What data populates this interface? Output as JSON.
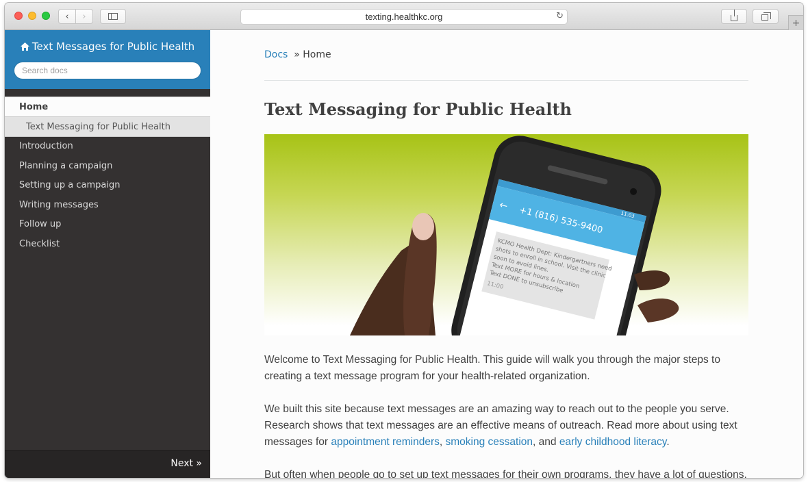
{
  "browser": {
    "url": "texting.healthkc.org",
    "back_glyph": "‹",
    "forward_glyph": "›",
    "reload_glyph": "↻",
    "new_tab_glyph": "+"
  },
  "sidebar": {
    "title": "Text Messages for Public Health",
    "home_icon": "home-icon",
    "search_placeholder": "Search docs",
    "current_item": "Home",
    "sub_item": "Text Messaging for Public Health",
    "items": [
      {
        "label": "Introduction"
      },
      {
        "label": "Planning a campaign"
      },
      {
        "label": "Setting up a campaign"
      },
      {
        "label": "Writing messages"
      },
      {
        "label": "Follow up"
      },
      {
        "label": "Checklist"
      }
    ],
    "next_label": "Next »",
    "accent_color": "#2980b9",
    "dark_color": "#343131"
  },
  "main": {
    "breadcrumb_root": "Docs",
    "breadcrumb_separator": "»",
    "breadcrumb_current": "Home",
    "title": "Text Messaging for Public Health",
    "phone": {
      "number": "+1 (816) 535-9400",
      "time": "11:03",
      "message_lines": [
        "KCMO Health Dept: Kindergartners need",
        "shots to enroll in school. Visit the clinic",
        "soon to avoid lines.",
        "Text MORE for hours & location",
        "Text DONE to unsubscribe"
      ],
      "message_time": "11:00"
    },
    "para1": "Welcome to Text Messaging for Public Health. This guide will walk you through the major steps to creating a text message program for your health-related organization.",
    "para2_start": "We built this site because text messages are an amazing way to reach out to the people you serve. Research shows that text messages are an effective means of outreach. Read more about using text messages for ",
    "link1": "appointment reminders",
    "comma": ", ",
    "link2": "smoking cessation",
    "and_text": ", and ",
    "link3": "early childhood literacy",
    "period": ".",
    "para3": "But often when people go to set up text messages for their own programs, they have a lot of questions."
  }
}
